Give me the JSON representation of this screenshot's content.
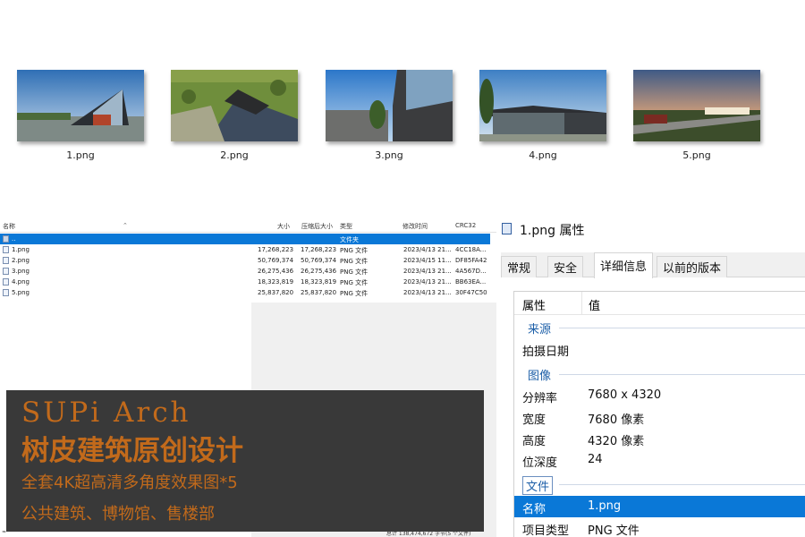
{
  "thumbnails": [
    {
      "label": "1.png"
    },
    {
      "label": "2.png"
    },
    {
      "label": "3.png"
    },
    {
      "label": "4.png"
    },
    {
      "label": "5.png"
    }
  ],
  "archive": {
    "columns": {
      "name": "名称",
      "size": "大小",
      "packed": "压缩后大小",
      "type": "类型",
      "modified": "修改时间",
      "crc": "CRC32"
    },
    "up_row": {
      "name": "..",
      "type": "文件夹"
    },
    "rows": [
      {
        "name": "1.png",
        "size": "17,268,223",
        "packed": "17,268,223",
        "type": "PNG 文件",
        "modified": "2023/4/13 21...",
        "crc": "4CC18A..."
      },
      {
        "name": "2.png",
        "size": "50,769,374",
        "packed": "50,769,374",
        "type": "PNG 文件",
        "modified": "2023/4/15 11...",
        "crc": "DF85FA42"
      },
      {
        "name": "3.png",
        "size": "26,275,436",
        "packed": "26,275,436",
        "type": "PNG 文件",
        "modified": "2023/4/13 21...",
        "crc": "4A567D..."
      },
      {
        "name": "4.png",
        "size": "18,323,819",
        "packed": "18,323,819",
        "type": "PNG 文件",
        "modified": "2023/4/13 21...",
        "crc": "BB63EA..."
      },
      {
        "name": "5.png",
        "size": "25,837,820",
        "packed": "25,837,820",
        "type": "PNG 文件",
        "modified": "2023/4/13 21...",
        "crc": "30F47C50"
      }
    ],
    "status_left": "≈",
    "status_right": "总计 138,474,672 字节(5 个文件)"
  },
  "banner": {
    "line1": "SUPi Arch",
    "line2": "树皮建筑原创设计",
    "line3": "全套4K超高清多角度效果图*5",
    "line4": "公共建筑、博物馆、售楼部",
    "color": "#c26a1b"
  },
  "properties": {
    "title": "1.png 属性",
    "tabs": [
      "常规",
      "安全",
      "详细信息",
      "以前的版本"
    ],
    "active_tab": "详细信息",
    "header": {
      "property": "属性",
      "value": "值"
    },
    "group_source": "来源",
    "date_taken": "拍摄日期",
    "group_image": "图像",
    "resolution_label": "分辨率",
    "resolution_value": "7680 x 4320",
    "width_label": "宽度",
    "width_value": "7680 像素",
    "height_label": "高度",
    "height_value": "4320 像素",
    "depth_label": "位深度",
    "depth_value": "24",
    "group_file": "文件",
    "name_label": "名称",
    "name_value": "1.png",
    "itemtype_label": "项目类型",
    "itemtype_value": "PNG 文件"
  }
}
